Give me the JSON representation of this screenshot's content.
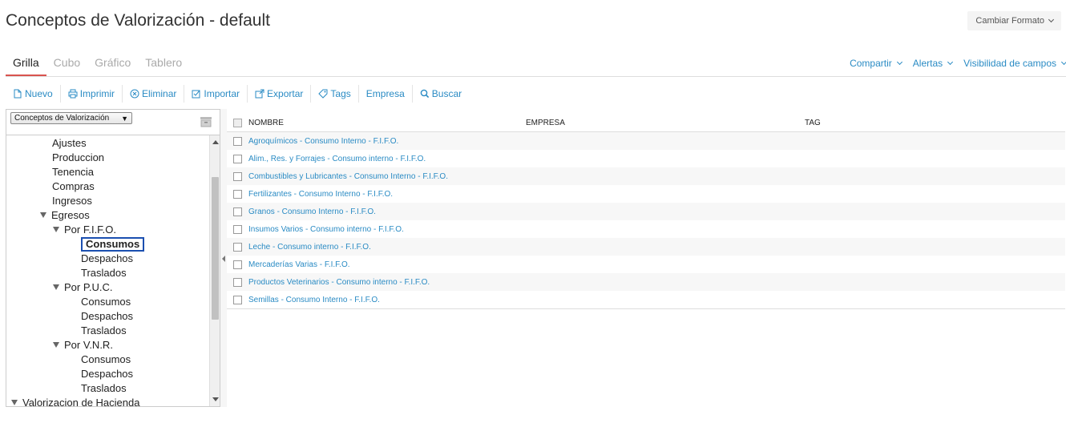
{
  "header": {
    "title": "Conceptos de Valorización - default",
    "format_button": "Cambiar Formato"
  },
  "tabs": [
    {
      "label": "Grilla",
      "active": true
    },
    {
      "label": "Cubo",
      "active": false
    },
    {
      "label": "Gráfico",
      "active": false
    },
    {
      "label": "Tablero",
      "active": false
    }
  ],
  "right_links": [
    "Compartir",
    "Alertas",
    "Visibilidad de campos"
  ],
  "toolbar": [
    {
      "label": "Nuevo",
      "icon": "new-file-icon"
    },
    {
      "label": "Imprimir",
      "icon": "printer-icon"
    },
    {
      "label": "Eliminar",
      "icon": "delete-circle-icon"
    },
    {
      "label": "Importar",
      "icon": "import-icon"
    },
    {
      "label": "Exportar",
      "icon": "export-icon"
    },
    {
      "label": "Tags",
      "icon": "tag-icon"
    },
    {
      "label": "Empresa",
      "icon": ""
    },
    {
      "label": "Buscar",
      "icon": "search-icon"
    }
  ],
  "tree": {
    "selector_value": "Conceptos de Valorización",
    "nodes": [
      {
        "label": "Ajustes",
        "level": 3,
        "expanded": null
      },
      {
        "label": "Produccion",
        "level": 3,
        "expanded": null
      },
      {
        "label": "Tenencia",
        "level": 3,
        "expanded": null
      },
      {
        "label": "Compras",
        "level": 3,
        "expanded": null
      },
      {
        "label": "Ingresos",
        "level": 3,
        "expanded": null
      },
      {
        "label": "Egresos",
        "level": 2,
        "expanded": true
      },
      {
        "label": "Por F.I.F.O.",
        "level": 3,
        "expanded": true
      },
      {
        "label": "Consumos",
        "level": 5,
        "expanded": null,
        "selected": true
      },
      {
        "label": "Despachos",
        "level": 5,
        "expanded": null
      },
      {
        "label": "Traslados",
        "level": 5,
        "expanded": null
      },
      {
        "label": "Por P.U.C.",
        "level": 3,
        "expanded": true
      },
      {
        "label": "Consumos",
        "level": 5,
        "expanded": null
      },
      {
        "label": "Despachos",
        "level": 5,
        "expanded": null
      },
      {
        "label": "Traslados",
        "level": 5,
        "expanded": null
      },
      {
        "label": "Por V.N.R.",
        "level": 3,
        "expanded": true
      },
      {
        "label": "Consumos",
        "level": 5,
        "expanded": null
      },
      {
        "label": "Despachos",
        "level": 5,
        "expanded": null
      },
      {
        "label": "Traslados",
        "level": 5,
        "expanded": null
      },
      {
        "label": "Valorizacion de Hacienda",
        "level": 0,
        "expanded": true
      }
    ]
  },
  "grid": {
    "columns": [
      "NOMBRE",
      "EMPRESA",
      "TAG"
    ],
    "rows": [
      {
        "nombre": "Agroquímicos - Consumo Interno - F.I.F.O.",
        "empresa": "",
        "tag": ""
      },
      {
        "nombre": "Alim., Res. y Forrajes - Consumo interno - F.I.F.O.",
        "empresa": "",
        "tag": ""
      },
      {
        "nombre": "Combustibles y Lubricantes - Consumo Interno - F.I.F.O.",
        "empresa": "",
        "tag": ""
      },
      {
        "nombre": "Fertilizantes - Consumo Interno - F.I.F.O.",
        "empresa": "",
        "tag": ""
      },
      {
        "nombre": "Granos - Consumo Interno - F.I.F.O.",
        "empresa": "",
        "tag": ""
      },
      {
        "nombre": "Insumos Varios - Consumo interno - F.I.F.O.",
        "empresa": "",
        "tag": ""
      },
      {
        "nombre": "Leche - Consumo interno - F.I.F.O.",
        "empresa": "",
        "tag": ""
      },
      {
        "nombre": "Mercaderías Varias - F.I.F.O.",
        "empresa": "",
        "tag": ""
      },
      {
        "nombre": "Productos Veterinarios - Consumo interno - F.I.F.O.",
        "empresa": "",
        "tag": ""
      },
      {
        "nombre": "Semillas - Consumo Interno - F.I.F.O.",
        "empresa": "",
        "tag": ""
      }
    ]
  }
}
